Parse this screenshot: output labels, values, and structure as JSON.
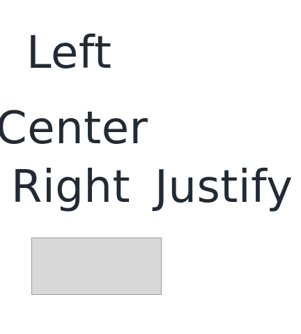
{
  "labels": {
    "left": "Left",
    "center": "Center",
    "right": "Right",
    "justify": "Justify"
  },
  "colors": {
    "text": "#222a33",
    "box_fill": "#d9d9d9",
    "box_border": "#9a9a9a",
    "background": "#ffffff"
  }
}
